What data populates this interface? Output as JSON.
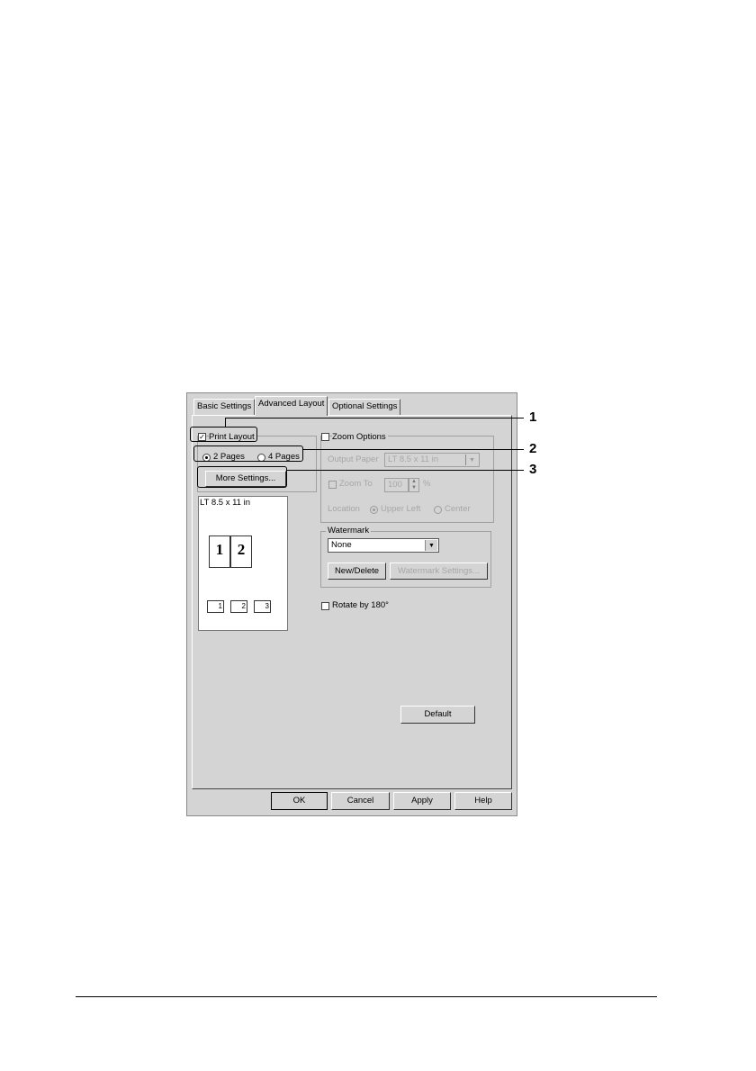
{
  "tabs": [
    "Basic Settings",
    "Advanced Layout",
    "Optional Settings"
  ],
  "print_layout": {
    "label": "Print Layout",
    "checked": true,
    "pages_options": [
      "2 Pages",
      "4 Pages"
    ],
    "selected": "2 Pages",
    "more_settings": "More Settings..."
  },
  "preview": {
    "paper": "LT 8.5 x 11 in",
    "page_numbers": [
      "1",
      "2"
    ],
    "order_icons": [
      "1",
      "2",
      "3"
    ]
  },
  "zoom": {
    "label": "Zoom Options",
    "output_paper_label": "Output Paper",
    "output_paper_value": "LT 8.5 x 11 in",
    "zoom_to_label": "Zoom To",
    "zoom_value": "100",
    "percent": "%",
    "location_label": "Location",
    "location_options": [
      "Upper Left",
      "Center"
    ]
  },
  "watermark": {
    "label": "Watermark",
    "value": "None",
    "new_delete": "New/Delete",
    "settings": "Watermark Settings..."
  },
  "rotate": {
    "label": "Rotate by 180°"
  },
  "default_button": "Default",
  "footer": {
    "ok": "OK",
    "cancel": "Cancel",
    "apply": "Apply",
    "help": "Help"
  },
  "callouts": [
    "1",
    "2",
    "3"
  ]
}
